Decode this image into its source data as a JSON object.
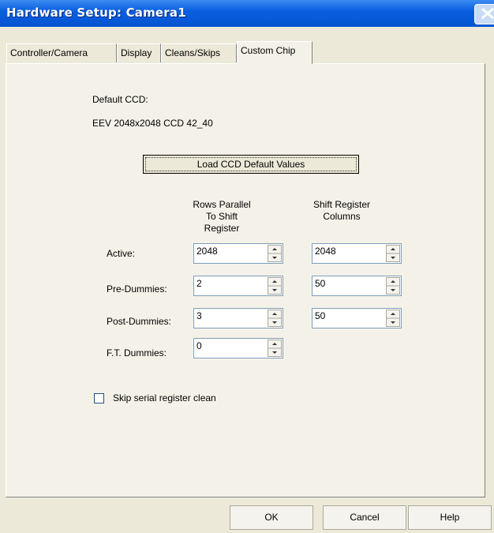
{
  "window": {
    "title": "Hardware Setup: Camera1",
    "close_icon": "close-x-icon"
  },
  "tabs": [
    {
      "label": "Controller/Camera",
      "active": false
    },
    {
      "label": "Display",
      "active": false
    },
    {
      "label": "Cleans/Skips",
      "active": false
    },
    {
      "label": "Custom Chip",
      "active": true
    }
  ],
  "ccd": {
    "default_label": "Default CCD:",
    "default_value": "EEV 2048x2048 CCD 42_40",
    "load_button": "Load CCD Default Values"
  },
  "columns": {
    "rows": [
      "Rows Parallel",
      "To Shift",
      "Register"
    ],
    "cols": [
      "Shift Register",
      "Columns"
    ]
  },
  "fields": [
    {
      "label": "Active:",
      "rows": "2048",
      "cols": "2048"
    },
    {
      "label": "Pre-Dummies:",
      "rows": "2",
      "cols": "50"
    },
    {
      "label": "Post-Dummies:",
      "rows": "3",
      "cols": "50"
    },
    {
      "label": "F.T. Dummies:",
      "rows": "0",
      "cols": null
    }
  ],
  "skip_clean": {
    "label": "Skip serial register clean",
    "checked": false
  },
  "buttons": {
    "ok": "OK",
    "cancel": "Cancel",
    "help": "Help"
  }
}
